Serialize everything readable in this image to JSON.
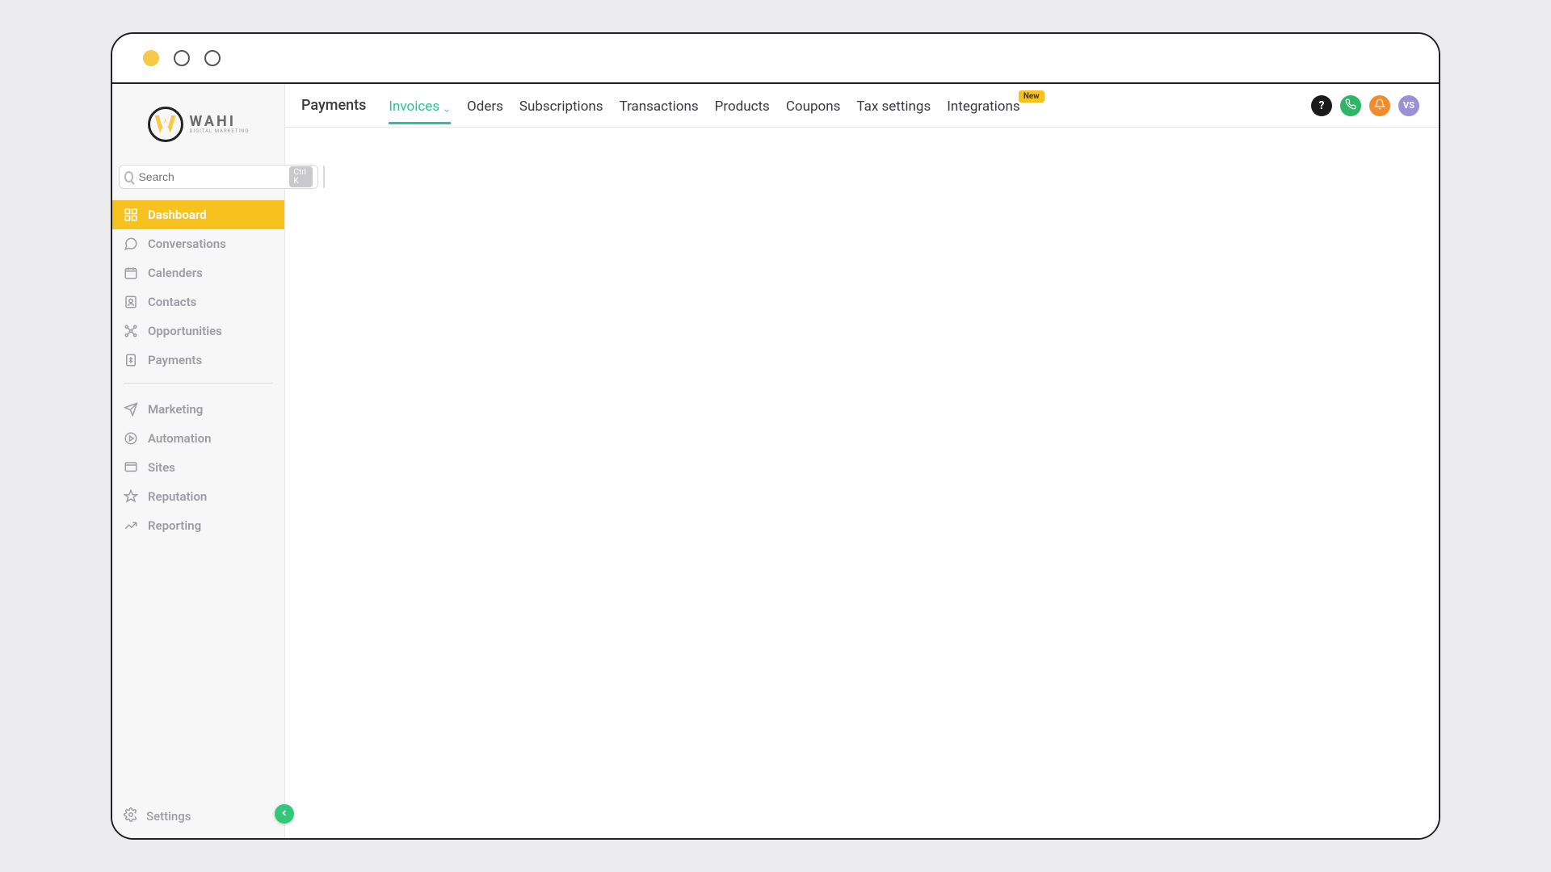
{
  "logo": {
    "name": "WAHI",
    "subtitle": "DIGITAL MARKETING"
  },
  "search": {
    "placeholder": "Search",
    "shortcut": "Ctrl K"
  },
  "sidebar": {
    "items": [
      {
        "label": "Dashboard",
        "icon": "grid-icon",
        "active": true
      },
      {
        "label": "Conversations",
        "icon": "chat-icon",
        "active": false
      },
      {
        "label": "Calenders",
        "icon": "calendar-icon",
        "active": false
      },
      {
        "label": "Contacts",
        "icon": "contacts-icon",
        "active": false
      },
      {
        "label": "Opportunities",
        "icon": "opportunities-icon",
        "active": false
      },
      {
        "label": "Payments",
        "icon": "payments-icon",
        "active": false
      }
    ],
    "items2": [
      {
        "label": "Marketing",
        "icon": "send-icon"
      },
      {
        "label": "Automation",
        "icon": "play-icon"
      },
      {
        "label": "Sites",
        "icon": "sites-icon"
      },
      {
        "label": "Reputation",
        "icon": "star-icon"
      },
      {
        "label": "Reporting",
        "icon": "trend-icon"
      }
    ],
    "settings_label": "Settings"
  },
  "topbar": {
    "title": "Payments",
    "tabs": [
      {
        "label": "Invoices",
        "active": true,
        "dropdown": true
      },
      {
        "label": "Oders",
        "active": false
      },
      {
        "label": "Subscriptions",
        "active": false
      },
      {
        "label": "Transactions",
        "active": false
      },
      {
        "label": "Products",
        "active": false
      },
      {
        "label": "Coupons",
        "active": false
      },
      {
        "label": "Tax settings",
        "active": false
      },
      {
        "label": "Integrations",
        "active": false,
        "badge": "New"
      }
    ],
    "avatar_initials": "VS"
  }
}
